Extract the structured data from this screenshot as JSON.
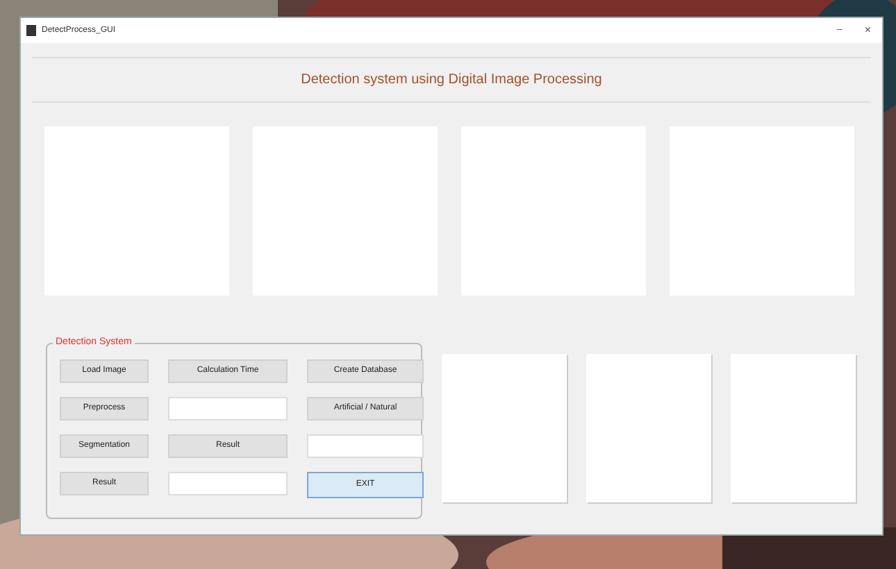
{
  "window": {
    "title": "DetectProcess_GUI",
    "controls": [
      "–",
      "×"
    ]
  },
  "heading": "Detection system using Digital Image Processing",
  "panel": {
    "title": "Detection System",
    "controls": [
      {
        "kind": "button",
        "label": "Load Image",
        "focused": false
      },
      {
        "kind": "button",
        "label": "Calculation Time",
        "focused": false
      },
      {
        "kind": "button",
        "label": "Create Database",
        "focused": false
      },
      {
        "kind": "button",
        "label": "Preprocess",
        "focused": false
      },
      {
        "kind": "field"
      },
      {
        "kind": "button",
        "label": "Artificial / Natural",
        "focused": false
      },
      {
        "kind": "button",
        "label": "Segmentation",
        "focused": false
      },
      {
        "kind": "button",
        "label": "Result",
        "focused": false
      },
      {
        "kind": "field"
      },
      {
        "kind": "button",
        "label": "Result",
        "focused": false
      },
      {
        "kind": "field"
      },
      {
        "kind": "button",
        "label": "EXIT",
        "focused": true
      }
    ]
  }
}
